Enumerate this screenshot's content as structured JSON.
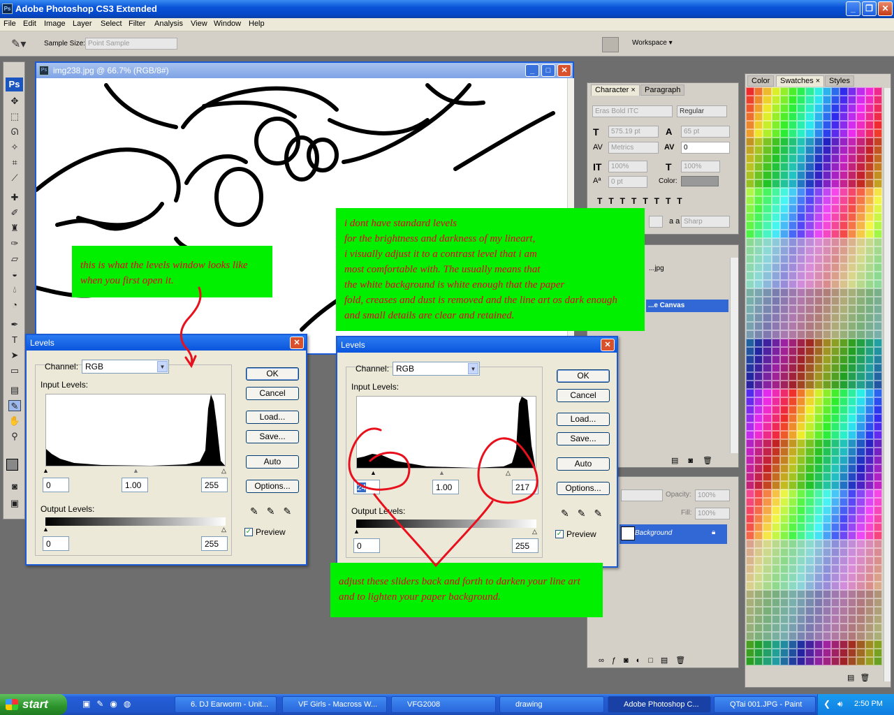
{
  "app": {
    "title": "Adobe Photoshop CS3 Extended",
    "icon": "Ps"
  },
  "menu": [
    "File",
    "Edit",
    "Image",
    "Layer",
    "Select",
    "Filter",
    "Analysis",
    "View",
    "Window",
    "Help"
  ],
  "options": {
    "sample_size_label": "Sample Size:",
    "sample_size_value": "Point Sample",
    "workspace": "Workspace"
  },
  "tools": {
    "logo": "Ps"
  },
  "document": {
    "title": "img238.jpg @ 66.7% (RGB/8#)"
  },
  "character_panel": {
    "tabs": [
      "Character",
      "Paragraph"
    ],
    "font_family": "Eras Bold ITC",
    "font_style": "Regular",
    "size": "575.19 pt",
    "leading": "65 pt",
    "kerning": "Metrics",
    "tracking": "0",
    "vscale": "100%",
    "hscale": "100%",
    "baseline": "0 pt",
    "color_label": "Color:",
    "antialias_label": "a a",
    "antialias": "Sharp"
  },
  "history_panel": {
    "item1": "...jpg",
    "item2": "...e Canvas"
  },
  "layers_panel": {
    "opacity_label": "Opacity:",
    "opacity": "100%",
    "fill_label": "Fill:",
    "fill": "100%",
    "layer_name": "Background"
  },
  "swatch_panel": {
    "tabs": [
      "Color",
      "Swatches",
      "Styles"
    ]
  },
  "levels_left": {
    "title": "Levels",
    "channel_label": "Channel:",
    "channel": "RGB",
    "input_label": "Input Levels:",
    "in_black": "0",
    "in_gamma": "1.00",
    "in_white": "255",
    "output_label": "Output Levels:",
    "out_black": "0",
    "out_white": "255",
    "ok": "OK",
    "cancel": "Cancel",
    "load": "Load...",
    "save": "Save...",
    "auto": "Auto",
    "options": "Options...",
    "preview": "Preview"
  },
  "levels_right": {
    "title": "Levels",
    "channel_label": "Channel:",
    "channel": "RGB",
    "input_label": "Input Levels:",
    "in_black": "24",
    "in_gamma": "1.00",
    "in_white": "217",
    "output_label": "Output Levels:",
    "out_black": "0",
    "out_white": "255",
    "ok": "OK",
    "cancel": "Cancel",
    "load": "Load...",
    "save": "Save...",
    "auto": "Auto",
    "options": "Options...",
    "preview": "Preview"
  },
  "notes": {
    "left": [
      "this is what the levels window looks like",
      "when you first open it."
    ],
    "top": [
      "i dont have standard levels",
      "for the brightness and darkness of my lineart,",
      "i visually adjust it to a contrast level that i am",
      "most comfortable with. The usually means that",
      "the white background is white enough that the paper",
      "fold, creases and dust is removed and the line art os dark enough",
      "and small details are clear and retained."
    ],
    "bottom": [
      "adjust these sliders back and forth to darken your line art",
      "and to lighten your paper background."
    ]
  },
  "taskbar": {
    "start": "start",
    "tasks": [
      "6. DJ Earworm - Unit...",
      "VF Girls - Macross W...",
      "VFG2008",
      "drawing",
      "Adobe Photoshop C...",
      "QTai 001.JPG - Paint"
    ],
    "clock": "2:50 PM"
  },
  "colors": {
    "note_bg": "#00f000",
    "note_text": "#e8001c",
    "xp_blue": "#0a55dd",
    "selected_layer": "#3168d5"
  }
}
